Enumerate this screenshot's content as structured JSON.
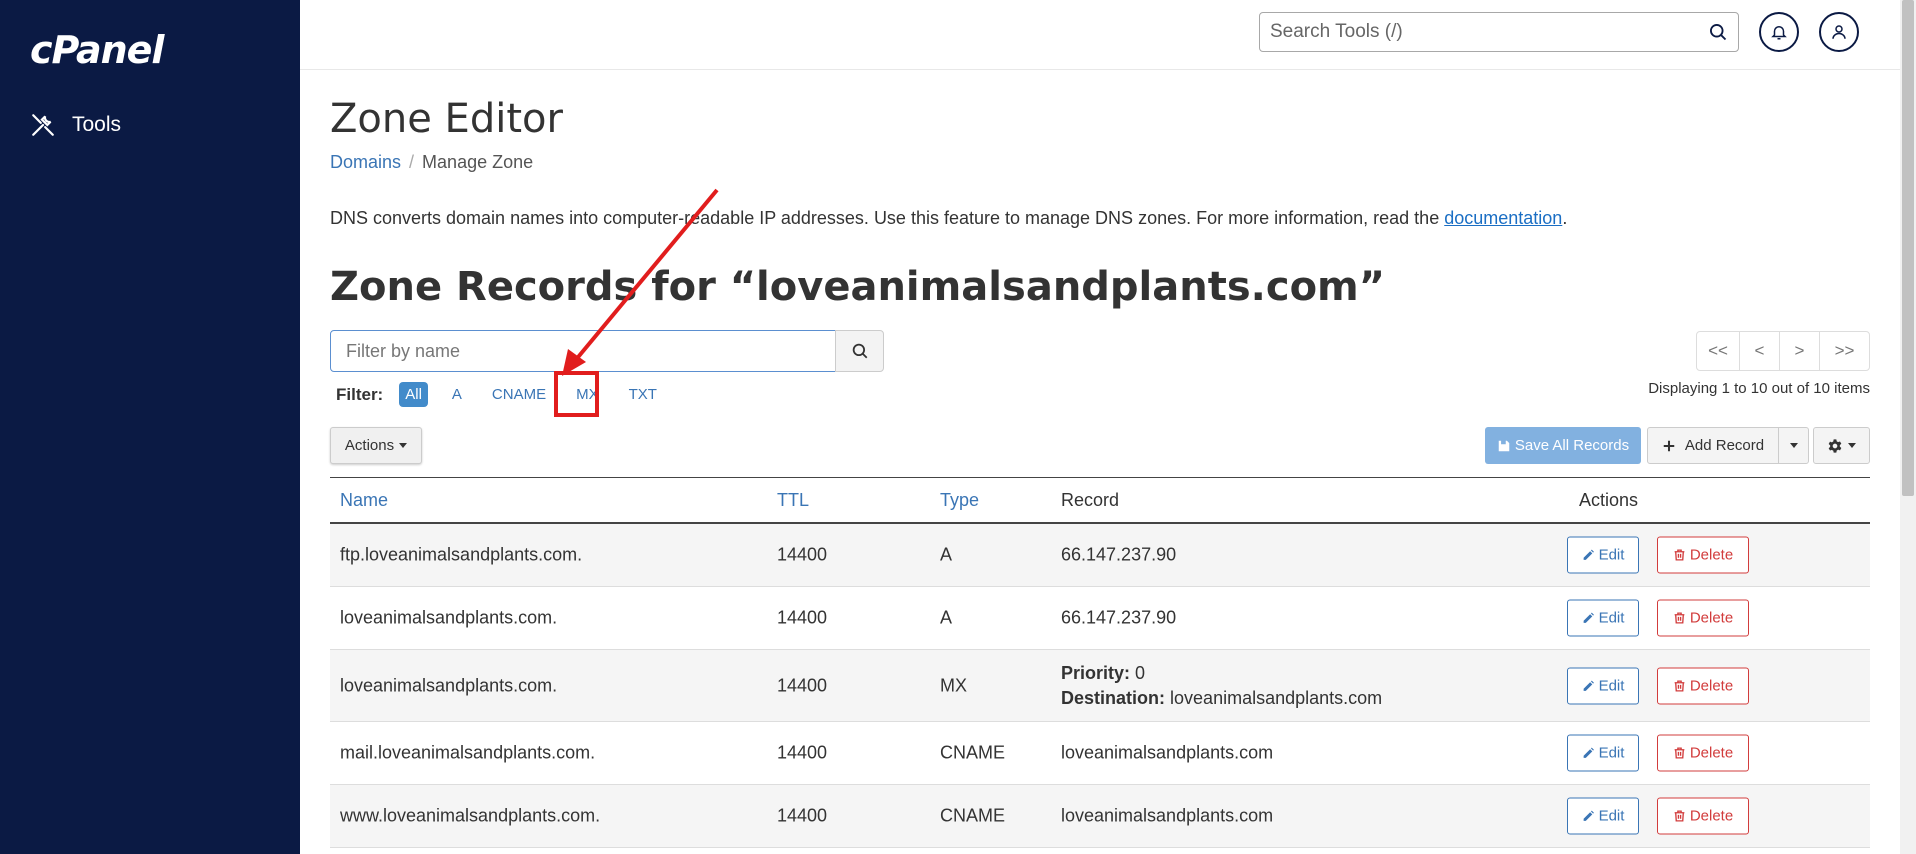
{
  "sidebar": {
    "logo": "cPanel",
    "items": [
      {
        "label": "Tools",
        "icon": "tools-icon"
      }
    ]
  },
  "topbar": {
    "search_placeholder": "Search Tools (/)",
    "icons": [
      "search-icon",
      "bell-icon",
      "user-icon"
    ]
  },
  "page": {
    "title": "Zone Editor",
    "breadcrumb": {
      "parent": "Domains",
      "current": "Manage Zone"
    },
    "description": "DNS converts domain names into computer-readable IP addresses. Use this feature to manage DNS zones. For more information, read the ",
    "description_link": "documentation",
    "description_end": ".",
    "zone_title": "Zone Records for “loveanimalsandplants.com”"
  },
  "filter": {
    "placeholder": "Filter by name",
    "label": "Filter:",
    "options": [
      "All",
      "A",
      "CNAME",
      "MX",
      "TXT"
    ],
    "selected": "All"
  },
  "pagination": {
    "buttons": [
      "<<",
      "<",
      ">",
      ">>"
    ],
    "info": "Displaying 1 to 10 out of 10 items"
  },
  "toolbar": {
    "actions_label": "Actions",
    "save_label": "Save All Records",
    "add_label": "Add Record"
  },
  "table": {
    "headers": {
      "name": "Name",
      "ttl": "TTL",
      "type": "Type",
      "record": "Record",
      "actions": "Actions"
    },
    "edit_label": "Edit",
    "delete_label": "Delete",
    "rows": [
      {
        "name": "ftp.loveanimalsandplants.com.",
        "ttl": "14400",
        "type": "A",
        "record": "66.147.237.90"
      },
      {
        "name": "loveanimalsandplants.com.",
        "ttl": "14400",
        "type": "A",
        "record": "66.147.237.90"
      },
      {
        "name": "loveanimalsandplants.com.",
        "ttl": "14400",
        "type": "MX",
        "priority_label": "Priority:",
        "priority": "0",
        "destination_label": "Destination:",
        "destination": "loveanimalsandplants.com"
      },
      {
        "name": "mail.loveanimalsandplants.com.",
        "ttl": "14400",
        "type": "CNAME",
        "record": "loveanimalsandplants.com"
      },
      {
        "name": "www.loveanimalsandplants.com.",
        "ttl": "14400",
        "type": "CNAME",
        "record": "loveanimalsandplants.com"
      }
    ]
  },
  "colors": {
    "sidebar_bg": "#0b1a44",
    "link": "#3a75b5",
    "annotation": "#e11d1d",
    "delete": "#d23c3c"
  }
}
